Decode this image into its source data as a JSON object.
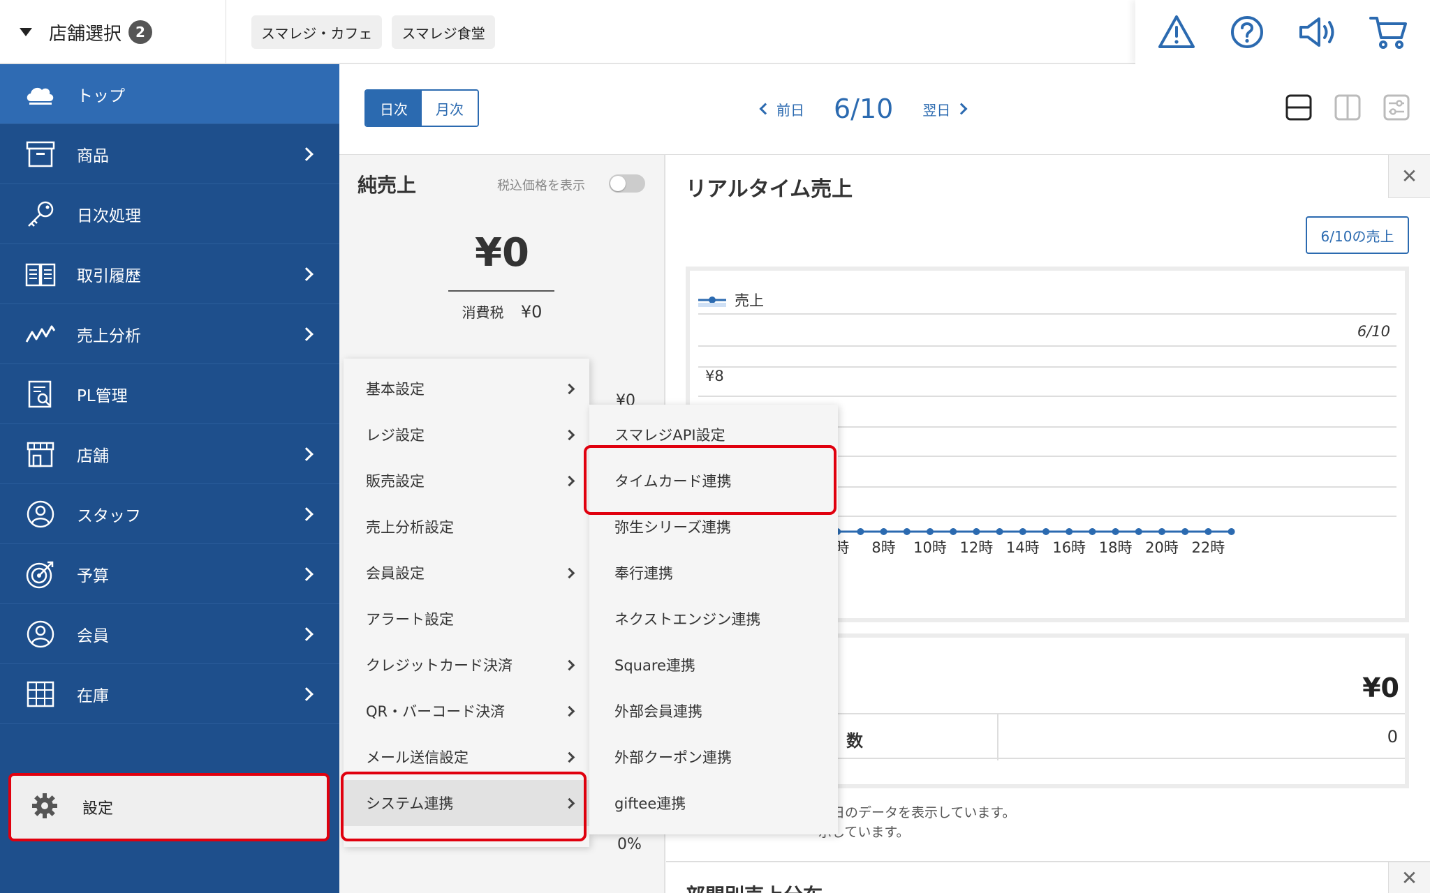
{
  "header": {
    "store_select_label": "店舗選択",
    "store_count": "2",
    "store_chips": [
      "スマレジ・カフェ",
      "スマレジ食堂"
    ],
    "icons": [
      "warning-icon",
      "help-icon",
      "announcement-icon",
      "cart-icon"
    ]
  },
  "sidebar": {
    "items": [
      {
        "label": "トップ",
        "icon": "cloud-icon",
        "has_submenu": false,
        "active": true
      },
      {
        "label": "商品",
        "icon": "box-icon",
        "has_submenu": true
      },
      {
        "label": "日次処理",
        "icon": "key-icon",
        "has_submenu": false
      },
      {
        "label": "取引履歴",
        "icon": "book-icon",
        "has_submenu": true
      },
      {
        "label": "売上分析",
        "icon": "analysis-icon",
        "has_submenu": true
      },
      {
        "label": "PL管理",
        "icon": "report-icon",
        "has_submenu": false
      },
      {
        "label": "店舗",
        "icon": "store-icon",
        "has_submenu": true
      },
      {
        "label": "スタッフ",
        "icon": "staff-icon",
        "has_submenu": true
      },
      {
        "label": "予算",
        "icon": "target-icon",
        "has_submenu": true
      },
      {
        "label": "会員",
        "icon": "member-icon",
        "has_submenu": true
      },
      {
        "label": "在庫",
        "icon": "inventory-icon",
        "has_submenu": true
      }
    ],
    "settings_label": "設定",
    "accent_color": "#1e4f8c",
    "highlight_color": "#e0000e"
  },
  "toolbar": {
    "daily_label": "日次",
    "monthly_label": "月次",
    "prev_label": "前日",
    "date": "6/10",
    "next_label": "翌日"
  },
  "net_sales": {
    "title": "純売上",
    "tax_toggle_label": "税込価格を表示",
    "amount": "¥0",
    "tax_label": "消費税",
    "tax_value": "¥0",
    "peek_value": "¥0",
    "peek_percent": "0%"
  },
  "realtime": {
    "title": "リアルタイム売上",
    "daily_sales_button": "6/10の売上",
    "summary_amount": "¥0",
    "summary_row_label": "数",
    "summary_row_value": "0",
    "note_line1": "当日のデータを表示しています。",
    "note_line2": "示しています。",
    "next_panel_title": "部門別売上分布"
  },
  "chart_data": {
    "type": "line",
    "legend": [
      "売上"
    ],
    "series": [
      {
        "name": "売上",
        "x": [
          0,
          1,
          2,
          3,
          4,
          5,
          6,
          7,
          8,
          9,
          10,
          11,
          12,
          13,
          14,
          15,
          16,
          17,
          18,
          19,
          20,
          21,
          22,
          23
        ],
        "values": [
          0,
          0,
          0,
          0,
          0,
          0,
          0,
          0,
          0,
          0,
          0,
          0,
          0,
          0,
          0,
          0,
          0,
          0,
          0,
          0,
          0,
          0,
          0,
          0
        ]
      }
    ],
    "x_tick_labels": [
      "6時",
      "8時",
      "10時",
      "12時",
      "14時",
      "16時",
      "18時",
      "20時",
      "22時"
    ],
    "y_tick_label": "¥8",
    "date_label": "6/10",
    "line_color": "#2b6ab0"
  },
  "settings_menu": {
    "items": [
      {
        "label": "基本設定",
        "has_submenu": true
      },
      {
        "label": "レジ設定",
        "has_submenu": true
      },
      {
        "label": "販売設定",
        "has_submenu": true
      },
      {
        "label": "売上分析設定",
        "has_submenu": false
      },
      {
        "label": "会員設定",
        "has_submenu": true
      },
      {
        "label": "アラート設定",
        "has_submenu": false
      },
      {
        "label": "クレジットカード決済",
        "has_submenu": true
      },
      {
        "label": "QR・バーコード決済",
        "has_submenu": true
      },
      {
        "label": "メール送信設定",
        "has_submenu": true
      },
      {
        "label": "システム連携",
        "has_submenu": true,
        "selected": true
      }
    ]
  },
  "system_menu": {
    "items": [
      {
        "label": "スマレジAPI設定"
      },
      {
        "label": "タイムカード連携",
        "highlighted": true
      },
      {
        "label": "弥生シリーズ連携"
      },
      {
        "label": "奉行連携"
      },
      {
        "label": "ネクストエンジン連携"
      },
      {
        "label": "Square連携"
      },
      {
        "label": "外部会員連携"
      },
      {
        "label": "外部クーポン連携"
      },
      {
        "label": "giftee連携"
      }
    ]
  }
}
